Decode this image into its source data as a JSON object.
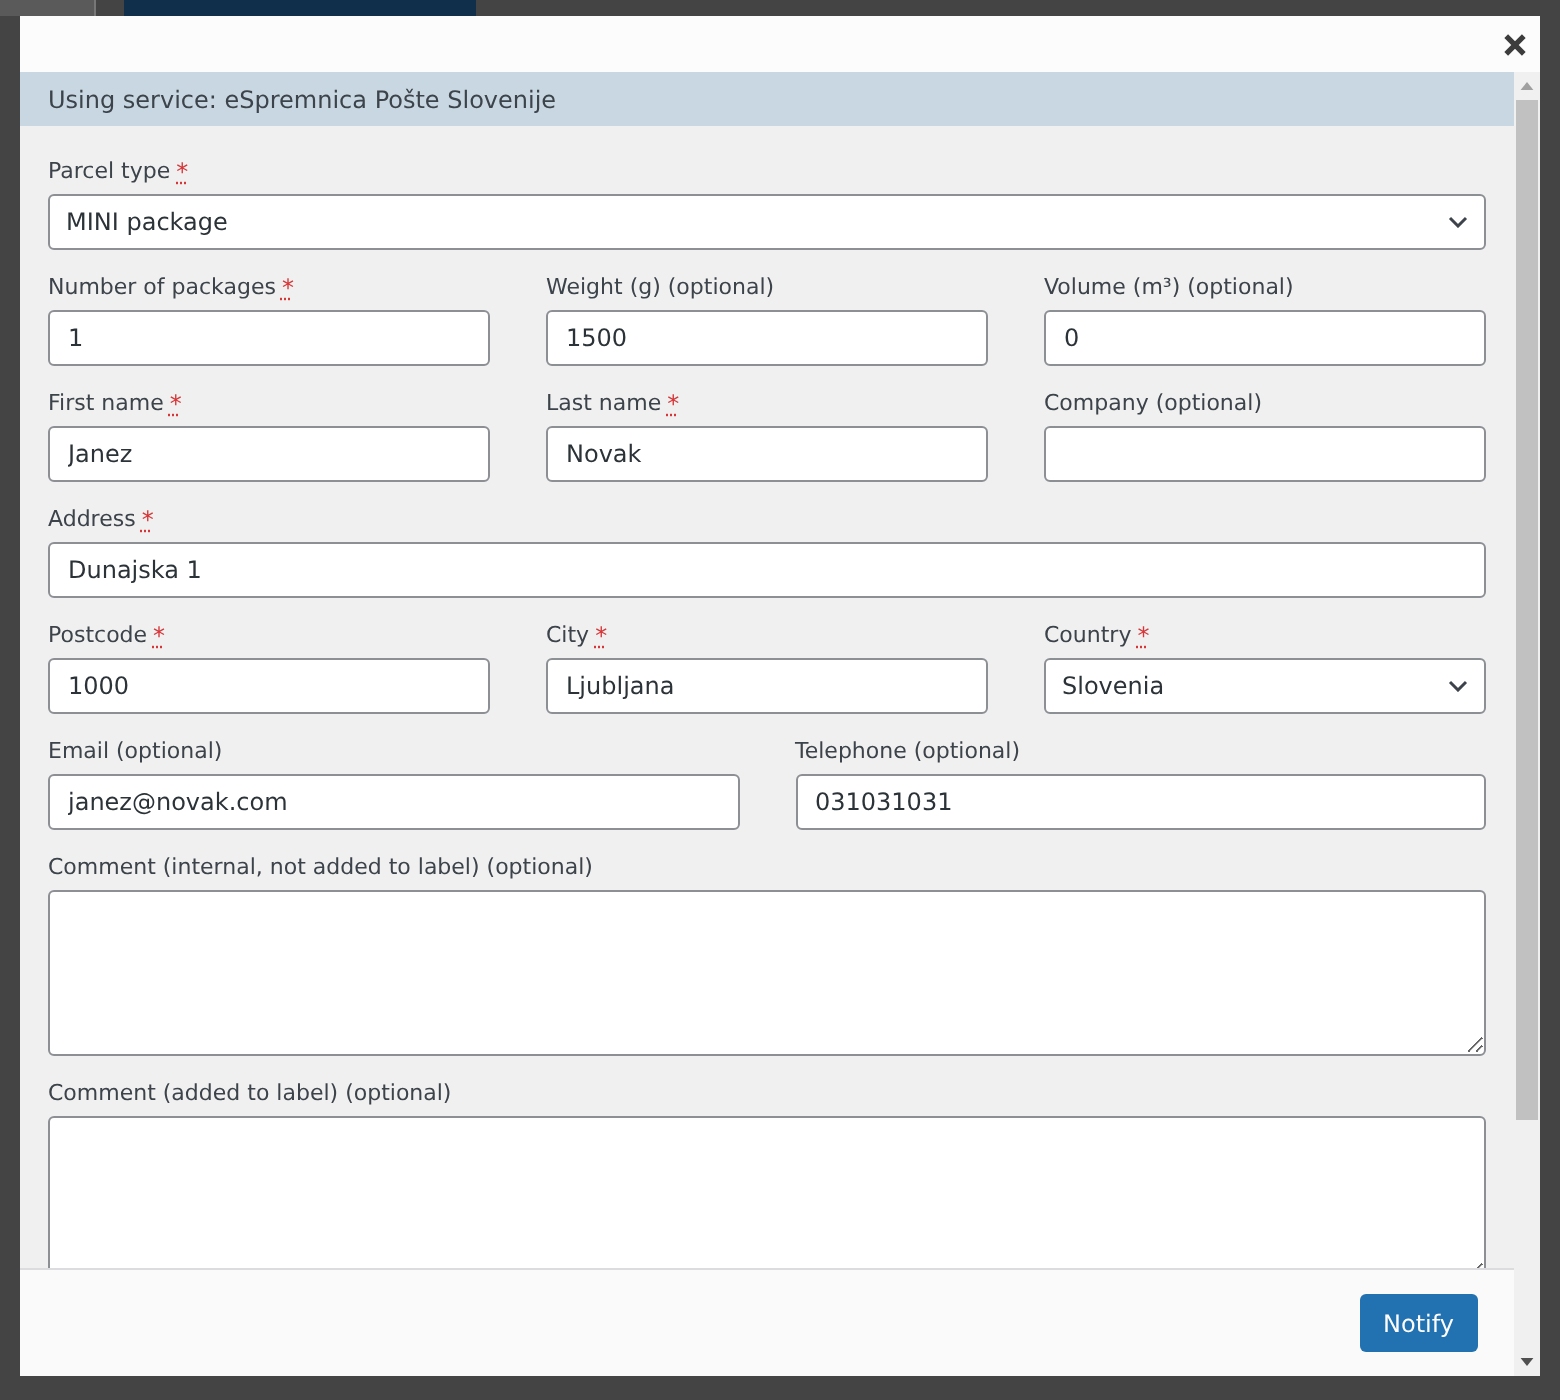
{
  "service_notice": "Using service: eSpremnica Pošte Slovenije",
  "form_rows": [
    [
      {
        "label": "Parcel type",
        "required_mark": "*",
        "kind": "select",
        "value": "MINI package"
      }
    ],
    [
      {
        "label": "Number of packages",
        "required_mark": "*",
        "kind": "input",
        "value": "1"
      },
      {
        "label": "Weight (g) (optional)",
        "kind": "input",
        "value": "1500"
      },
      {
        "label": "Volume (m³) (optional)",
        "kind": "input",
        "value": "0"
      }
    ],
    [
      {
        "label": "First name",
        "required_mark": "*",
        "kind": "input",
        "value": "Janez"
      },
      {
        "label": "Last name",
        "required_mark": "*",
        "kind": "input",
        "value": "Novak"
      },
      {
        "label": "Company (optional)",
        "kind": "input"
      }
    ],
    [
      {
        "label": "Address",
        "required_mark": "*",
        "kind": "input",
        "value": "Dunajska 1"
      }
    ],
    [
      {
        "label": "Postcode",
        "required_mark": "*",
        "kind": "input",
        "value": "1000"
      },
      {
        "label": "City",
        "required_mark": "*",
        "kind": "input",
        "value": "Ljubljana"
      },
      {
        "label": "Country",
        "required_mark": "*",
        "kind": "select",
        "value": "Slovenia"
      }
    ],
    [
      {
        "label": "Email (optional)",
        "kind": "input",
        "value": "janez@novak.com"
      },
      {
        "label": "Telephone (optional)",
        "kind": "input",
        "value": "031031031"
      }
    ],
    [
      {
        "label": "Comment (internal, not added to label) (optional)",
        "kind": "textarea"
      }
    ],
    [
      {
        "label": "Comment (added to label) (optional)",
        "kind": "textarea"
      }
    ]
  ],
  "footer": {
    "button": "Notify"
  }
}
